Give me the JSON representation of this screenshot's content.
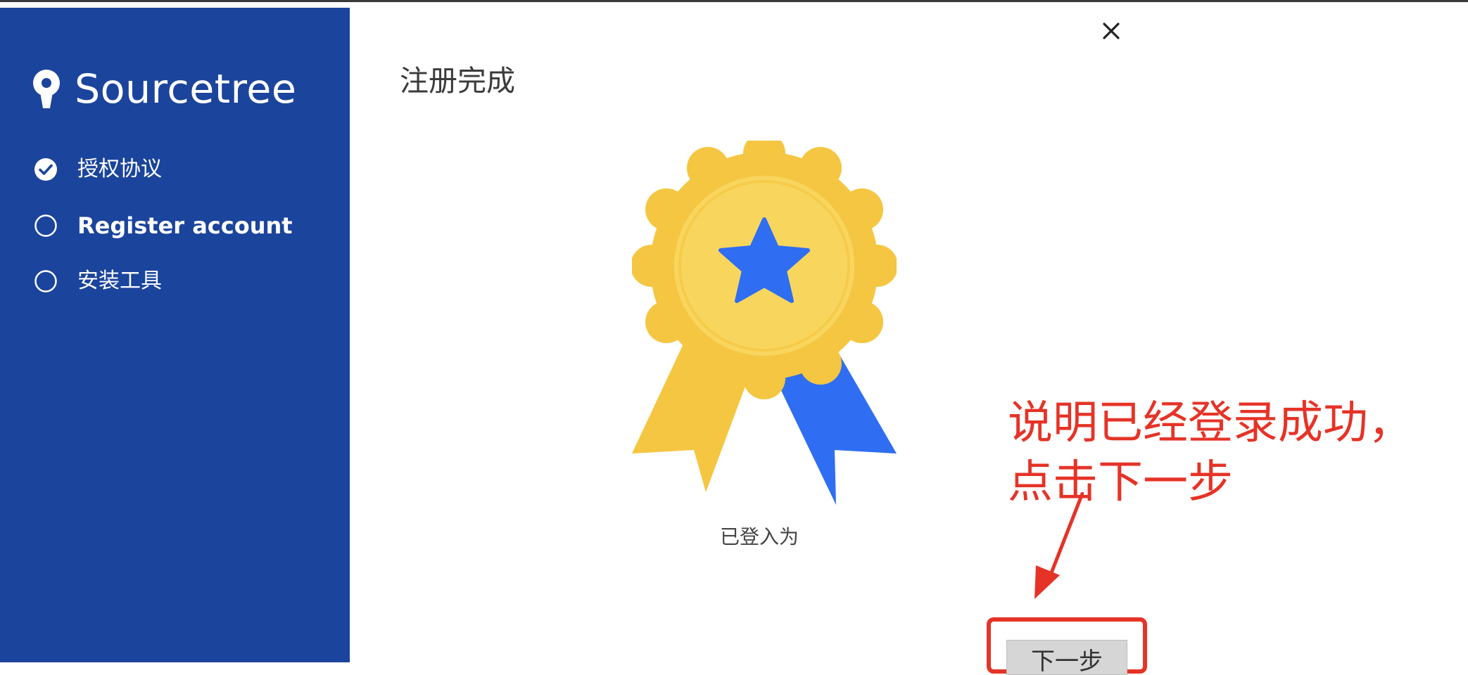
{
  "app": {
    "name": "Sourcetree"
  },
  "sidebar": {
    "steps": [
      {
        "label": "授权协议",
        "state": "completed",
        "icon": "check-circle-icon"
      },
      {
        "label": "Register account",
        "state": "current",
        "icon": "circle-outline-icon"
      },
      {
        "label": "安装工具",
        "state": "pending",
        "icon": "circle-outline-icon"
      }
    ]
  },
  "dialog": {
    "close_symbol": "×",
    "title": "注册完成",
    "badge_icon": "award-ribbon-icon",
    "logged_in_text": "已登入为",
    "next_button": "下一步"
  },
  "annotation": {
    "line1": "说明已经登录成功，",
    "line2": "点击下一步"
  },
  "colors": {
    "sidebar_bg": "#1b449c",
    "annotation_red": "#e63327",
    "medal_gold": "#f5c642",
    "medal_blue": "#2f6ef2"
  }
}
